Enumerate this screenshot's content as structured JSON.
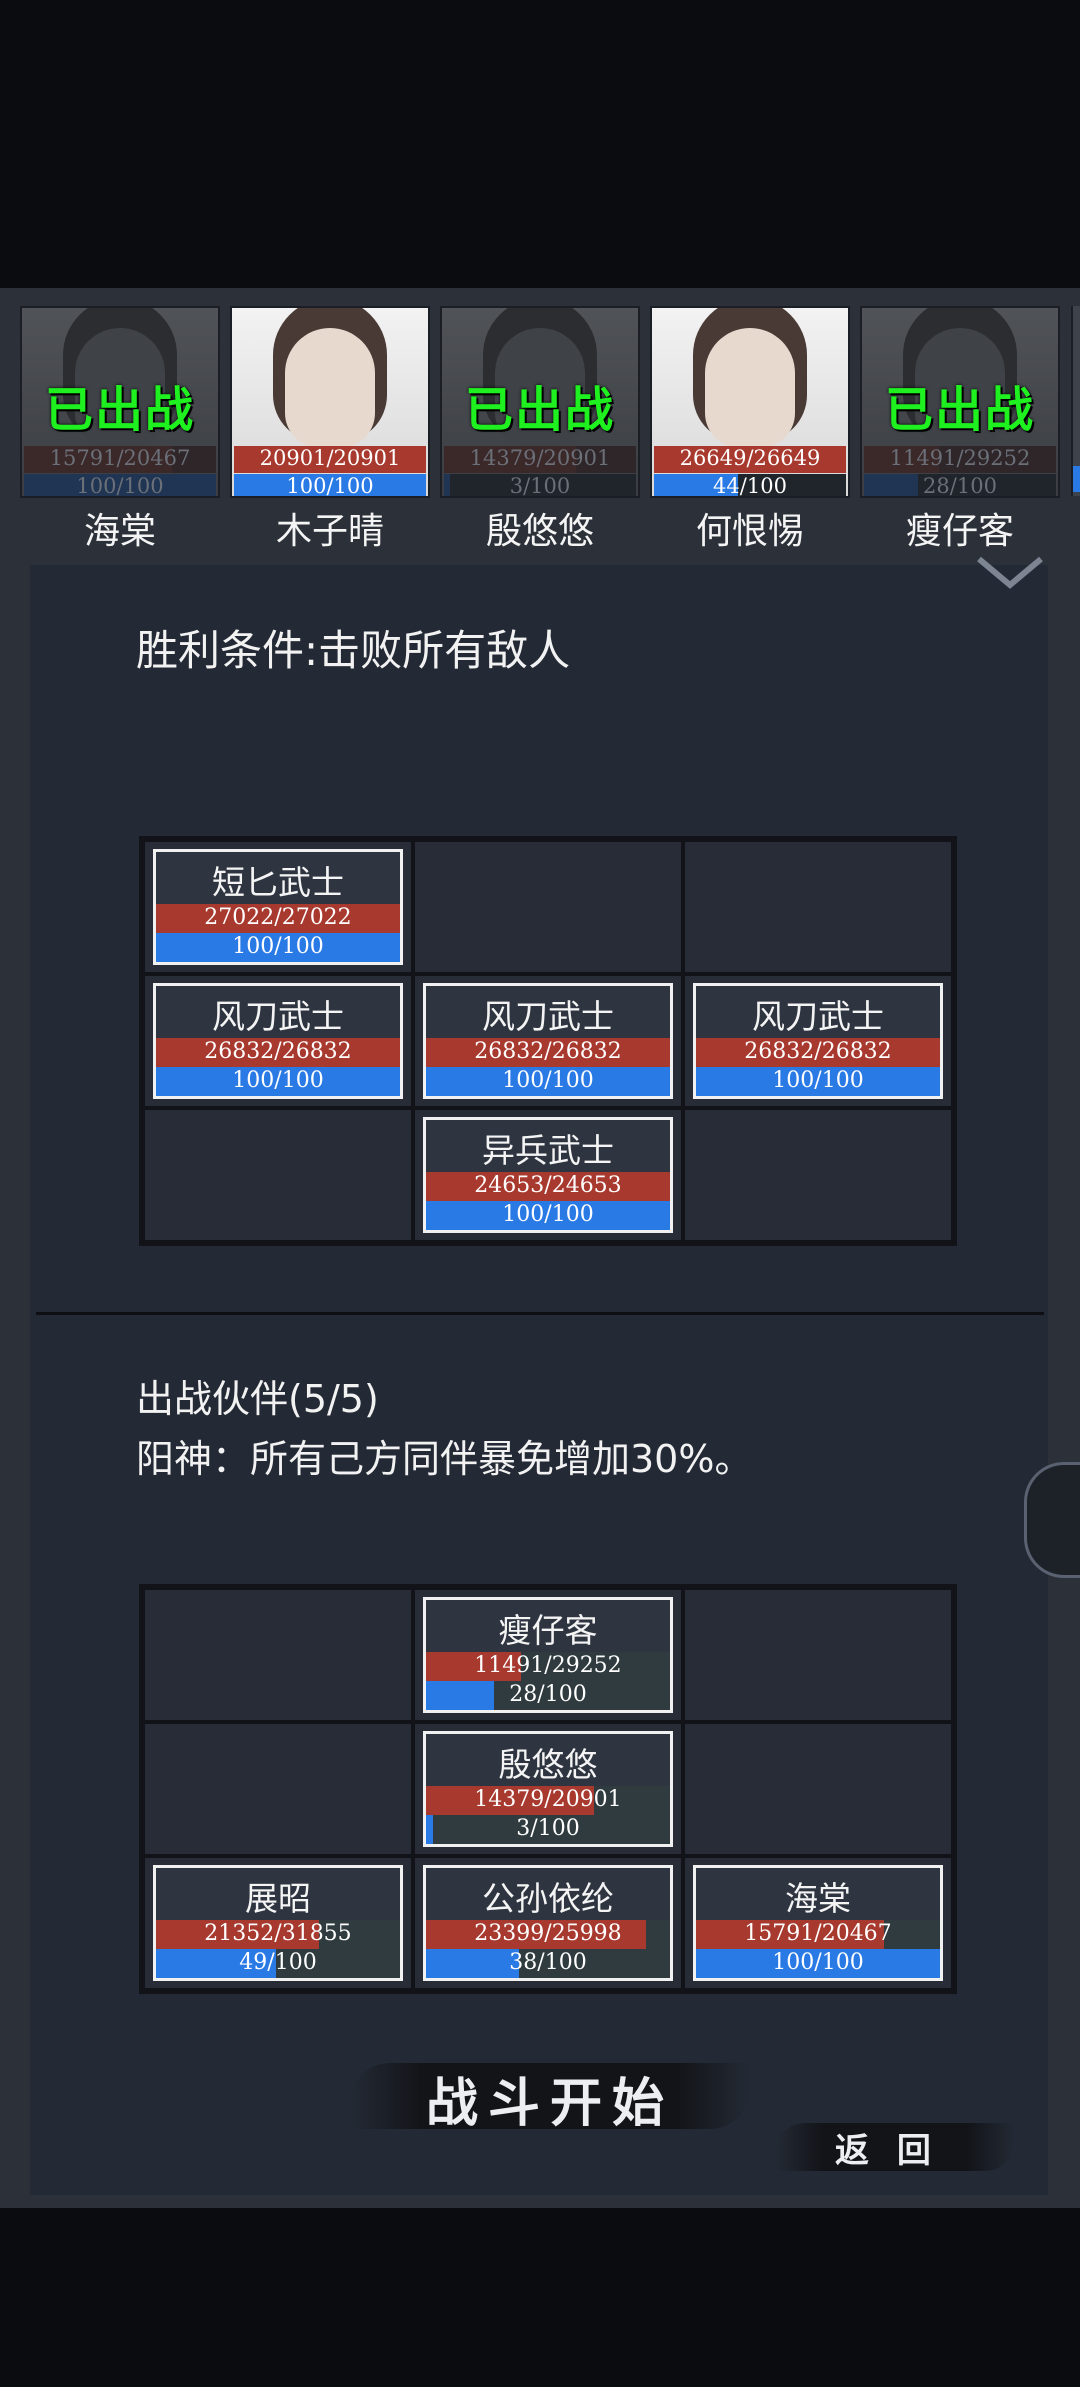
{
  "roster": [
    {
      "name": "海棠",
      "hp": "15791/20467",
      "hp_ratio": 0.77,
      "mp": "100/100",
      "mp_ratio": 1.0,
      "deployed": true,
      "badge": "已出战"
    },
    {
      "name": "木子晴",
      "hp": "20901/20901",
      "hp_ratio": 1.0,
      "mp": "100/100",
      "mp_ratio": 1.0,
      "deployed": false,
      "badge": ""
    },
    {
      "name": "殷悠悠",
      "hp": "14379/20901",
      "hp_ratio": 0.69,
      "mp": "3/100",
      "mp_ratio": 0.03,
      "deployed": true,
      "badge": "已出战"
    },
    {
      "name": "何恨惕",
      "hp": "26649/26649",
      "hp_ratio": 1.0,
      "mp": "44/100",
      "mp_ratio": 0.44,
      "deployed": false,
      "badge": ""
    },
    {
      "name": "瘦仔客",
      "hp": "11491/29252",
      "hp_ratio": 0.39,
      "mp": "28/100",
      "mp_ratio": 0.28,
      "deployed": true,
      "badge": "已出战"
    }
  ],
  "victory_condition": "胜利条件:击败所有敌人",
  "enemies": {
    "r0c0": {
      "name": "短匕武士",
      "hp": "27022/27022",
      "hp_ratio": 1.0,
      "mp": "100/100",
      "mp_ratio": 1.0
    },
    "r1c0": {
      "name": "风刀武士",
      "hp": "26832/26832",
      "hp_ratio": 1.0,
      "mp": "100/100",
      "mp_ratio": 1.0
    },
    "r1c1": {
      "name": "风刀武士",
      "hp": "26832/26832",
      "hp_ratio": 1.0,
      "mp": "100/100",
      "mp_ratio": 1.0
    },
    "r1c2": {
      "name": "风刀武士",
      "hp": "26832/26832",
      "hp_ratio": 1.0,
      "mp": "100/100",
      "mp_ratio": 1.0
    },
    "r2c1": {
      "name": "异兵武士",
      "hp": "24653/24653",
      "hp_ratio": 1.0,
      "mp": "100/100",
      "mp_ratio": 1.0
    }
  },
  "team_title": "出战伙伴(5/5)",
  "team_bonus": "阳神：所有己方同伴暴免增加30%。",
  "allies": {
    "r0c1": {
      "name": "瘦仔客",
      "hp": "11491/29252",
      "hp_ratio": 0.39,
      "mp": "28/100",
      "mp_ratio": 0.28
    },
    "r1c1": {
      "name": "殷悠悠",
      "hp": "14379/20901",
      "hp_ratio": 0.69,
      "mp": "3/100",
      "mp_ratio": 0.03
    },
    "r2c0": {
      "name": "展昭",
      "hp": "21352/31855",
      "hp_ratio": 0.67,
      "mp": "49/100",
      "mp_ratio": 0.49
    },
    "r2c1": {
      "name": "公孙依纶",
      "hp": "23399/25998",
      "hp_ratio": 0.9,
      "mp": "38/100",
      "mp_ratio": 0.38
    },
    "r2c2": {
      "name": "海棠",
      "hp": "15791/20467",
      "hp_ratio": 0.77,
      "mp": "100/100",
      "mp_ratio": 1.0
    }
  },
  "start_button": "战斗开始",
  "back_button": "返 回",
  "colors": {
    "hp": "#a8392e",
    "mp": "#2a7ae6",
    "deployed": "#1ff01f",
    "panel": "#242a35"
  }
}
